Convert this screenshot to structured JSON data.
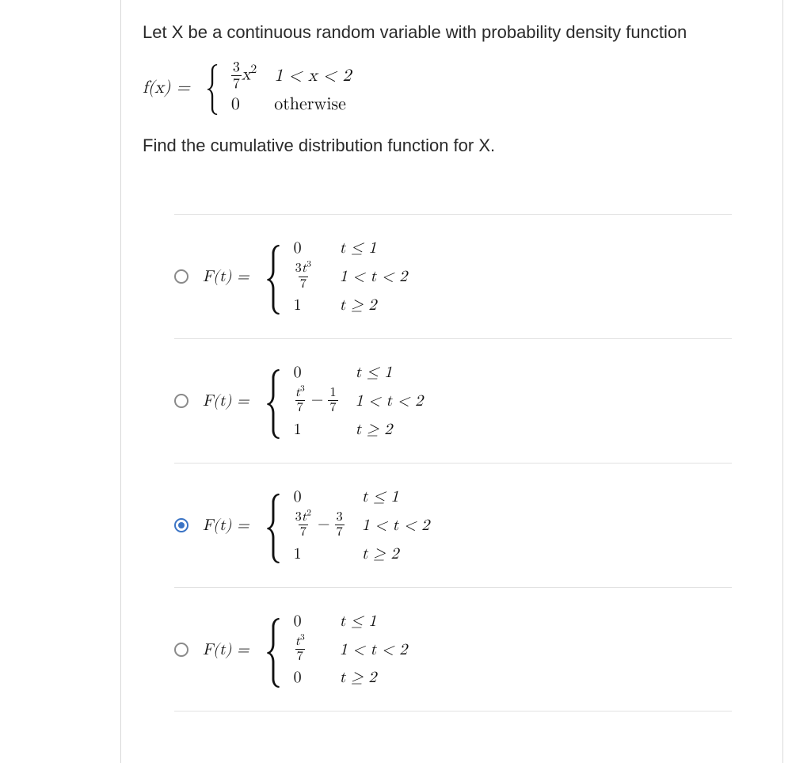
{
  "question": {
    "intro": "Let X be a continuous random variable with probability density function",
    "lhs": "f(x) =",
    "pdf": {
      "row1_value_num": "3",
      "row1_value_den": "7",
      "row1_var": "x",
      "row1_exp": "2",
      "row1_cond": "1 < x < 2",
      "row2_value": "0",
      "row2_cond": "otherwise"
    },
    "prompt": "Find the cumulative distribution function for X."
  },
  "options": [
    {
      "selected": false,
      "lhs": "F(t) =",
      "rows": [
        {
          "value_html": "0",
          "cond": "t ≤ 1"
        },
        {
          "value_html": "FRAC(3t^3|7)",
          "cond": "1 < t < 2"
        },
        {
          "value_html": "1",
          "cond": "t ≥ 2"
        }
      ]
    },
    {
      "selected": false,
      "lhs": "F(t) =",
      "rows": [
        {
          "value_html": "0",
          "cond": "t ≤ 1"
        },
        {
          "value_html": "FRAC(t^3|7) - FRAC(1|7)",
          "cond": "1 < t < 2"
        },
        {
          "value_html": "1",
          "cond": "t ≥ 2"
        }
      ]
    },
    {
      "selected": true,
      "lhs": "F(t) =",
      "rows": [
        {
          "value_html": "0",
          "cond": "t ≤ 1"
        },
        {
          "value_html": "FRAC(3t^2|7) - FRAC(3|7)",
          "cond": "1 < t < 2"
        },
        {
          "value_html": "1",
          "cond": "t ≥ 2"
        }
      ]
    },
    {
      "selected": false,
      "lhs": "F(t) =",
      "rows": [
        {
          "value_html": "0",
          "cond": "t ≤ 1"
        },
        {
          "value_html": "FRAC(t^3|7)",
          "cond": "1 < t < 2"
        },
        {
          "value_html": "0",
          "cond": "t ≥ 2"
        }
      ]
    }
  ]
}
